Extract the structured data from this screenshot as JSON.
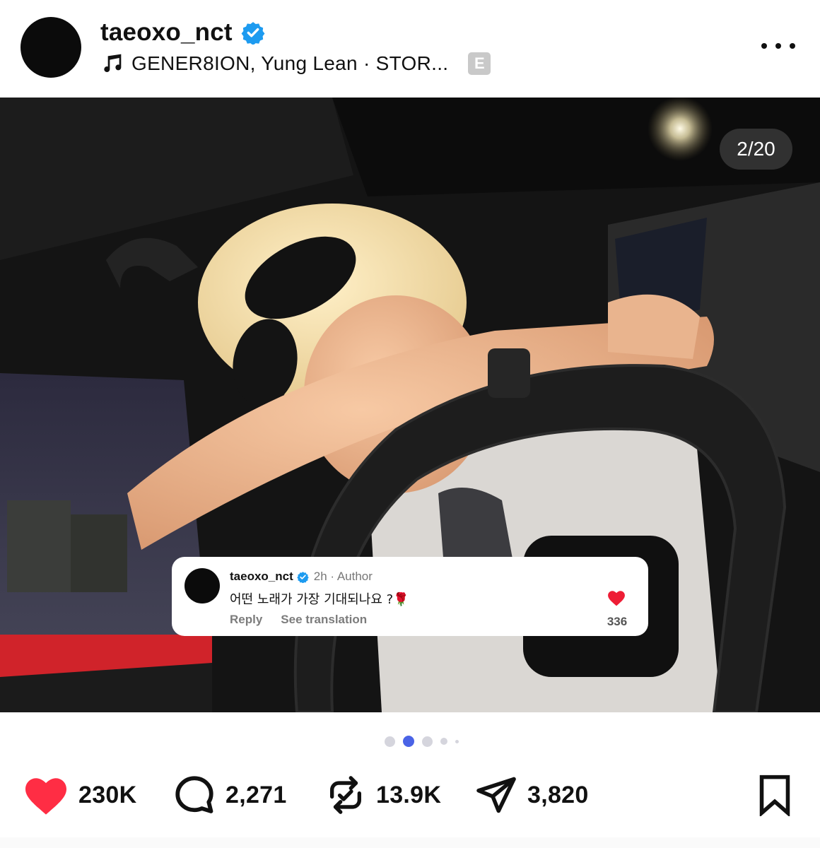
{
  "post": {
    "username": "taeoxo_nct",
    "verified_icon": "verified-badge-icon",
    "music": "GENER8ION, Yung Lean · STOR...",
    "explicit_badge": "E",
    "more_icon": "more-horizontal-icon"
  },
  "media": {
    "counter": "2/20",
    "pager": {
      "count": 5,
      "active_index": 1
    }
  },
  "comment": {
    "username": "taeoxo_nct",
    "meta": "2h · Author",
    "text": "어떤 노래가 가장 기대되나요 ?🌹",
    "reply_label": "Reply",
    "translate_label": "See translation",
    "like_count": "336",
    "heart_color": "#ee1d35"
  },
  "actions": {
    "likes": "230K",
    "comments": "2,271",
    "reposts": "13.9K",
    "shares": "3,820"
  },
  "colors": {
    "like_red": "#ff2d44",
    "verified_blue": "#1d9bf0",
    "active_dot": "#4a63e6",
    "inactive_dot": "#d5d5dd"
  }
}
